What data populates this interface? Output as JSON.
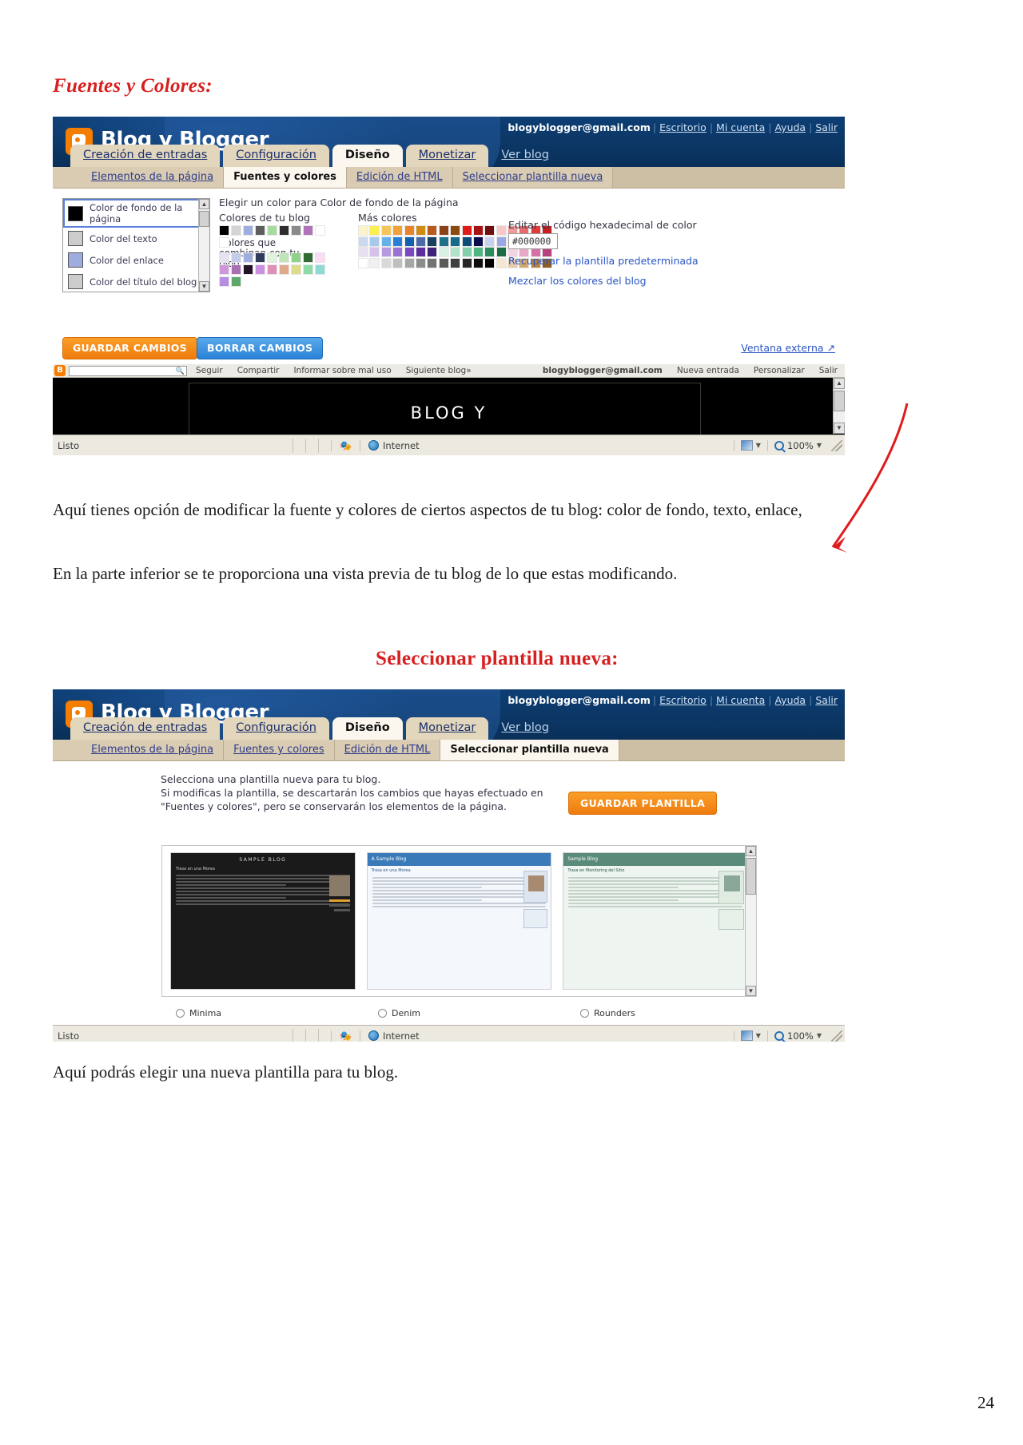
{
  "document": {
    "heading_1": "Fuentes y Colores:",
    "heading_2": "Seleccionar plantilla nueva:",
    "paragraph_1": "Aquí tienes opción de modificar la fuente y colores de ciertos aspectos de tu blog: color de fondo, texto, enlace,",
    "paragraph_2": "En la parte inferior se te proporciona una vista previa de tu blog de lo que estas modificando.",
    "paragraph_3": "Aquí podrás elegir una nueva plantilla para tu blog.",
    "page_number": "24",
    "heading_color": "#d81f1f",
    "arrow_color": "#e01b1b"
  },
  "blogger": {
    "brand_title": "Blog y Blogger",
    "brand_color": "#f57d00",
    "header_color": "#0b3666",
    "account_email": "blogyblogger@gmail.com",
    "account_links": [
      "Escritorio",
      "Mi cuenta",
      "Ayuda",
      "Salir"
    ],
    "tabs": [
      {
        "label": "Creación de entradas",
        "active": false
      },
      {
        "label": "Configuración",
        "active": false
      },
      {
        "label": "Diseño",
        "active": true
      },
      {
        "label": "Monetizar",
        "active": false
      },
      {
        "label": "Ver blog",
        "active": false,
        "plain": true
      }
    ],
    "subnav_fonts": [
      {
        "label": "Elementos de la página",
        "active": false
      },
      {
        "label": "Fuentes y colores",
        "active": true
      },
      {
        "label": "Edición de HTML",
        "active": false
      },
      {
        "label": "Seleccionar plantilla nueva",
        "active": false
      }
    ],
    "subnav_template": [
      {
        "label": "Elementos de la página",
        "active": false
      },
      {
        "label": "Fuentes y colores",
        "active": false
      },
      {
        "label": "Edición de HTML",
        "active": false
      },
      {
        "label": "Seleccionar plantilla nueva",
        "active": true
      }
    ]
  },
  "fonts_colors": {
    "color_items": [
      {
        "label": "Color de fondo de la página",
        "swatch": "#000000",
        "selected": true
      },
      {
        "label": "Color del texto",
        "swatch": "#cccccc",
        "selected": false
      },
      {
        "label": "Color del enlace",
        "swatch": "#9fadde",
        "selected": false
      },
      {
        "label": "Color del título del blog",
        "swatch": "#cccccc",
        "selected": false
      }
    ],
    "chooser_title": "Elegir un color para Color de fondo de la página",
    "label_blog_colors": "Colores de tu blog",
    "label_matching_colors": "Colores que combinan con tu blog",
    "label_more_colors": "Más colores",
    "label_hex": "Editar el código hexadecimal de color",
    "hex_value": "#000000",
    "hex_placeholder": "#000000",
    "link_restore": "Recuperar la plantilla predeterminada",
    "link_mix": "Mezclar los colores del blog",
    "button_save": "GUARDAR CAMBIOS",
    "button_clear": "BORRAR CAMBIOS",
    "button_save_color": "#ef7b0d",
    "button_clear_color": "#2a82d8",
    "external_window": "Ventana externa",
    "blog_colors": [
      "#000000",
      "#d4d4d4",
      "#9fadde",
      "#5e5e5e",
      "#a5dba0",
      "#2d2d2d",
      "#8a8a8a",
      "#b072b8",
      "#ffffff",
      "#ffffff"
    ],
    "matching_colors": [
      "#e3e3f2",
      "#c3cdeb",
      "#9fadde",
      "#2f3a5c",
      "#dff3dc",
      "#bfe5b8",
      "#8fd08a",
      "#2f6b33",
      "#fbdcf2",
      "#cf96d8",
      "#a96fb3",
      "#241426",
      "#c98fe0",
      "#e08fb8",
      "#e0a98c",
      "#dedb8c",
      "#8fdba8",
      "#8fdbd4",
      "#b88fe0",
      "#5fa86b"
    ],
    "more_colors_rows": [
      [
        "#fdf3c8",
        "#fbef51",
        "#f6c55a",
        "#f0a13a",
        "#e8832a",
        "#cf8b12",
        "#b95a1e",
        "#8a4218",
        "#8c4a12",
        "#e01b1b",
        "#a81212",
        "#6f0f0f",
        "#f6c8c8",
        "#f09a9a",
        "#ec6a6a",
        "#e03b3b",
        "#c51f1f"
      ],
      [
        "#cbd9ef",
        "#a8c9ee",
        "#66b2e8",
        "#2c7ed4",
        "#1560ac",
        "#4a6aa8",
        "#17405e",
        "#1d7189",
        "#176b8a",
        "#0f4b78",
        "#0b0b4d",
        "#c8d0ef",
        "#9aa9e4",
        "#6a7fd6",
        "#3b52b8",
        "#1f2f8c",
        "#121a5c"
      ],
      [
        "#e8dff2",
        "#d4c2ea",
        "#b79ae0",
        "#9a72d4",
        "#7c4ac0",
        "#5c2d9e",
        "#40217a",
        "#d8f0e2",
        "#b0e2c8",
        "#82cfa9",
        "#4fb583",
        "#2d8c5e",
        "#1a6b45",
        "#f4d4e4",
        "#e8a8c8",
        "#d86fa8",
        "#b8407f"
      ],
      [
        "#ffffff",
        "#f0f0f0",
        "#d9d9d9",
        "#bfbfbf",
        "#a6a6a6",
        "#8c8c8c",
        "#737373",
        "#595959",
        "#404040",
        "#262626",
        "#0d0d0d",
        "#000000",
        "#f5e6d0",
        "#e8cba8",
        "#d4a86f",
        "#b8833f",
        "#8c5f20"
      ]
    ]
  },
  "preview_bar": {
    "items": [
      "Seguir",
      "Compartir",
      "Informar sobre mal uso",
      "Siguiente blog»"
    ],
    "account_email": "blogyblogger@gmail.com",
    "right_items": [
      "Nueva entrada",
      "Personalizar",
      "Salir"
    ],
    "search_placeholder": "",
    "blog_title": "BLOG Y"
  },
  "status_bar": {
    "text": "Listo",
    "zone": "Internet",
    "zoom": "100%"
  },
  "template_chooser": {
    "line_1": "Selecciona una plantilla nueva para tu blog.",
    "line_2": "Si modificas la plantilla, se descartarán los cambios que hayas efectuado en \"Fuentes y colores\", pero se conservarán los elementos de la página.",
    "button_save": "GUARDAR PLANTILLA",
    "templates": [
      {
        "name": "Minima",
        "title": "SAMPLE BLOG",
        "post_title": "Trasa en una Morea",
        "style": "dark"
      },
      {
        "name": "Denim",
        "title": "A Sample Blog",
        "post_title": "Trasa en una Morea",
        "style": "blue"
      },
      {
        "name": "Rounders",
        "title": "Sample Blog",
        "post_title": "Trasa en Monitoring del Sitio",
        "style": "teal"
      }
    ]
  }
}
